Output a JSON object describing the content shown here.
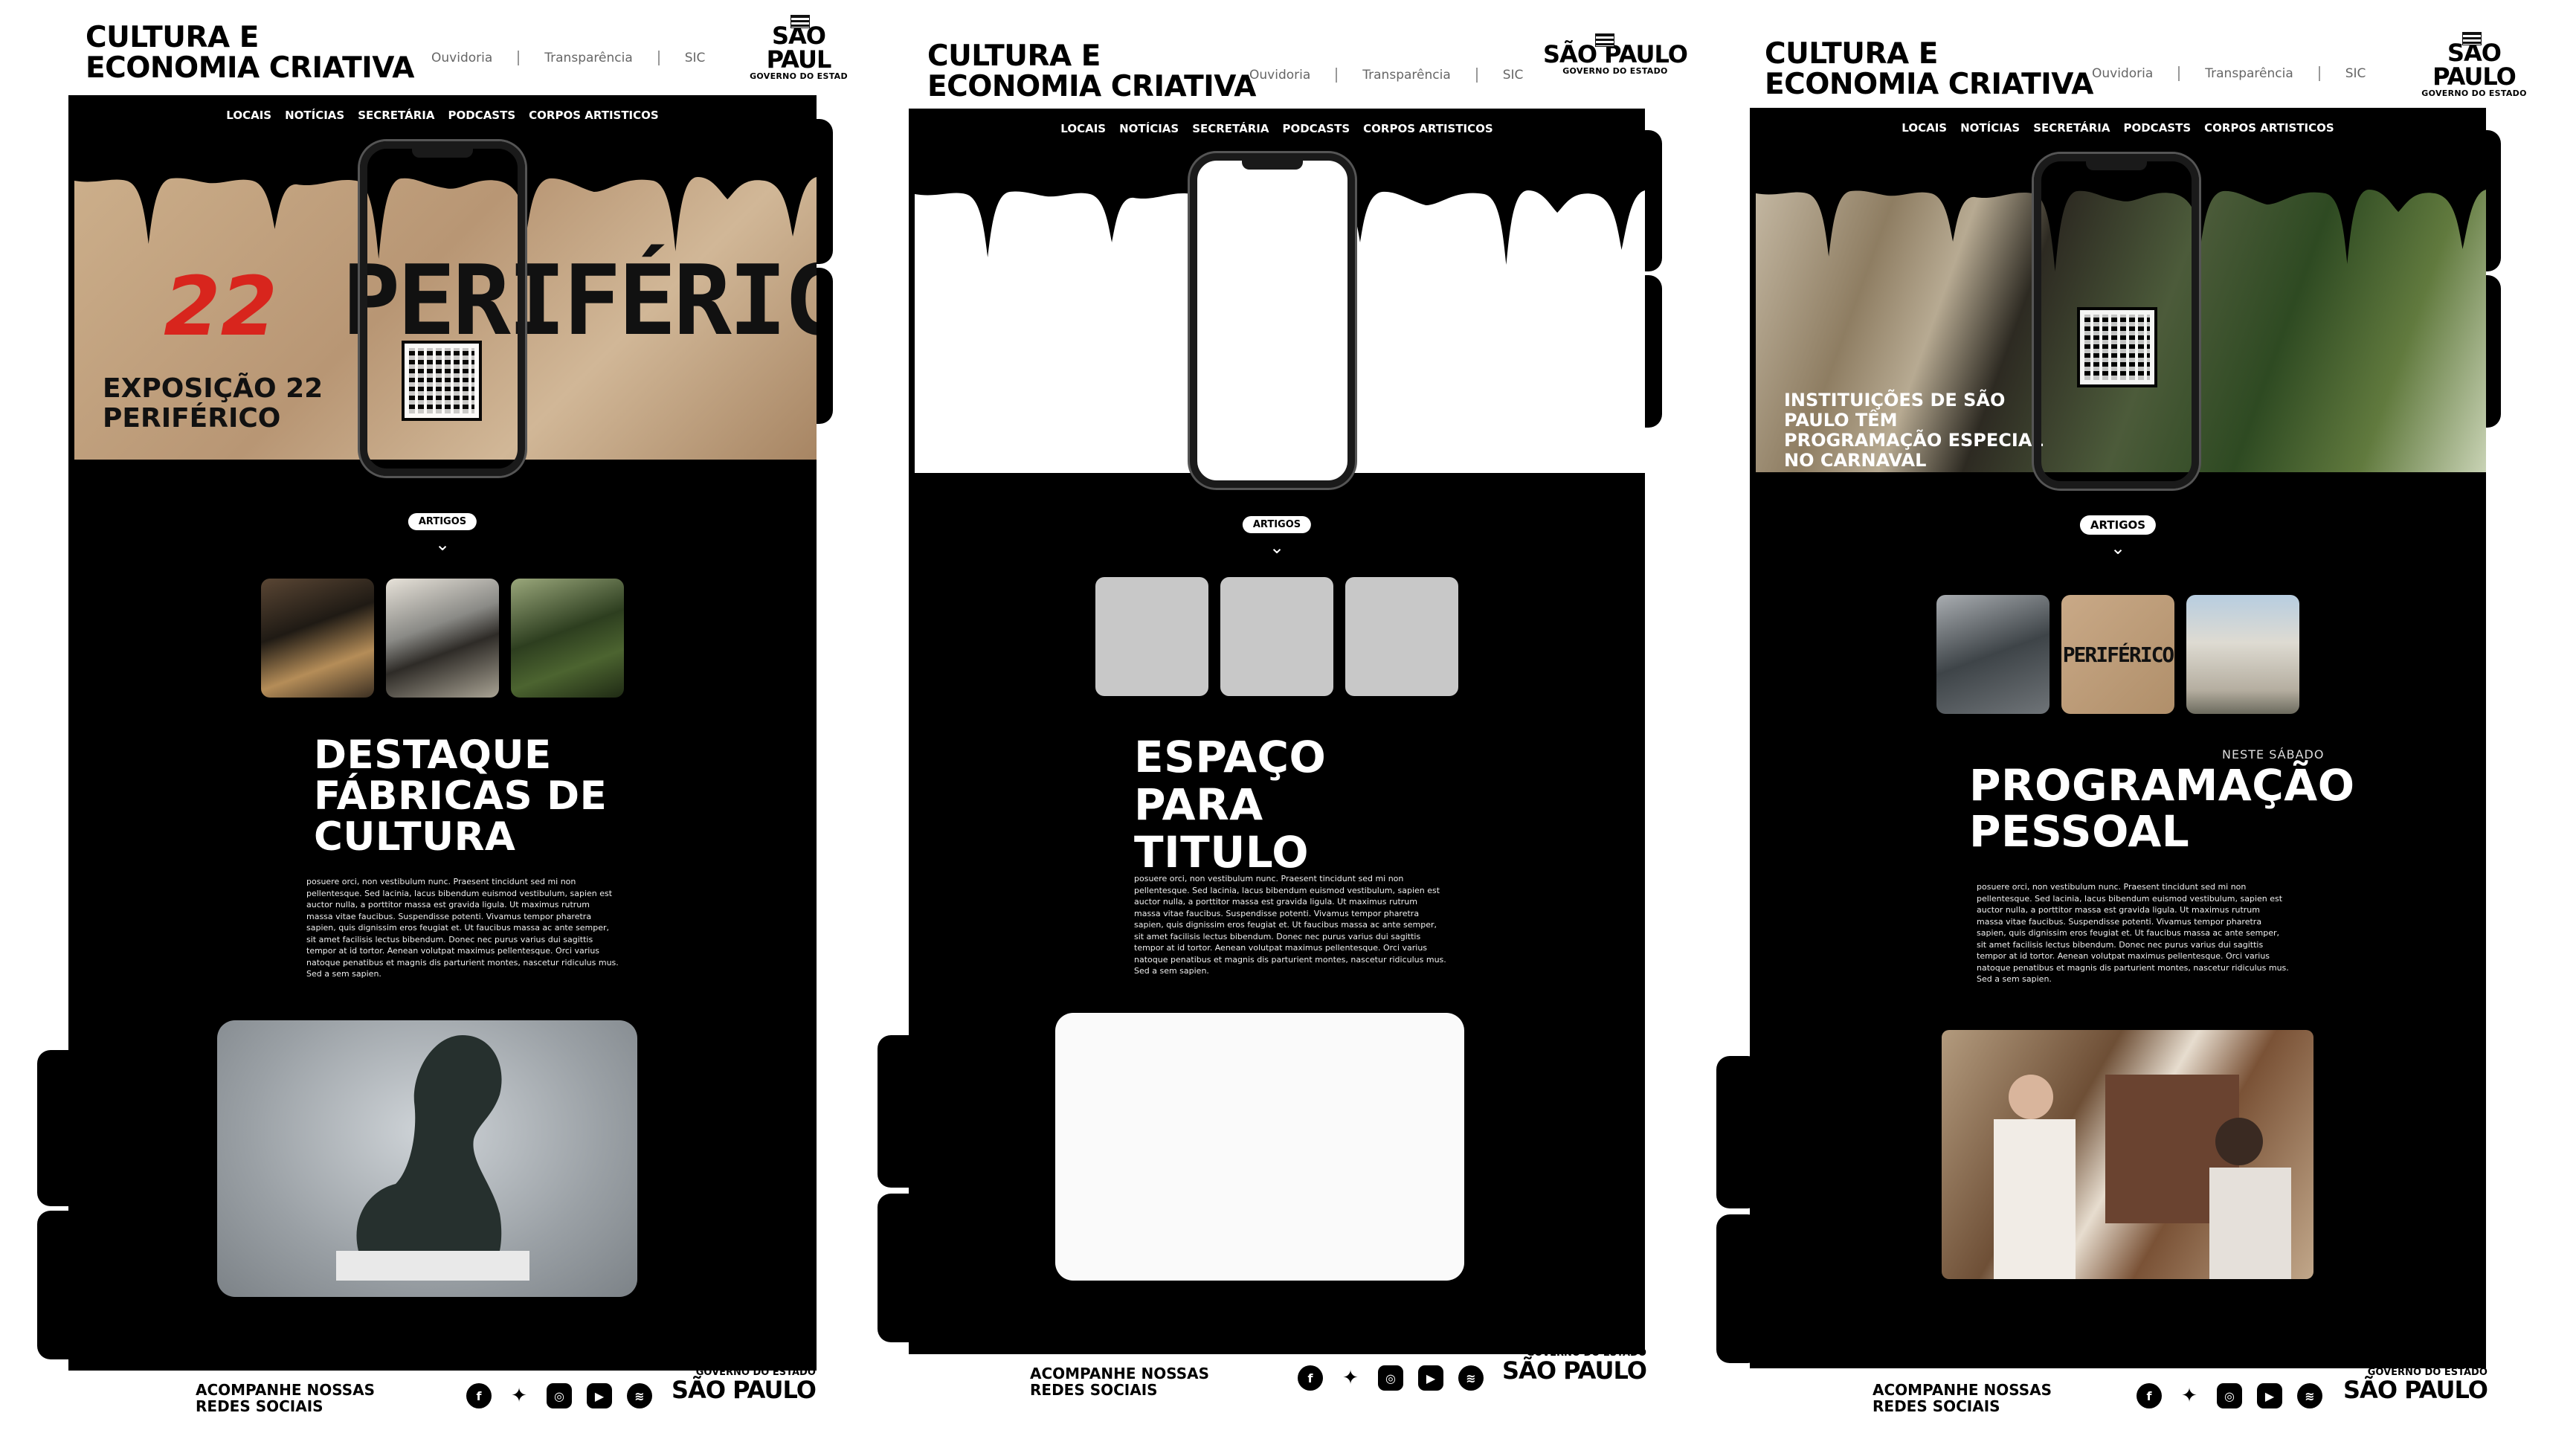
{
  "header": {
    "title_line1": "CULTURA E",
    "title_line2": "ECONOMIA CRIATIVA",
    "links": [
      "Ouvidoria",
      "Transparência",
      "SIC"
    ],
    "logo_main": "SÃO PAULO",
    "logo_sub": "GOVERNO DO ESTADO",
    "logo_main_clipped": "SÃO PAUL",
    "logo_sub_clipped": "GOVERNO DO ESTAD"
  },
  "nav": [
    "LOCAIS",
    "NOTÍCIAS",
    "SECRETÁRIA",
    "PODCASTS",
    "CORPOS ARTISTICOS"
  ],
  "panel1": {
    "hero_brand_num": "22",
    "hero_brand_word": "PERIFÉRICO",
    "hero_title": "EXPOSIÇÃO 22 PERIFÉRICO",
    "section_tag": "ARTIGOS",
    "section_title": "DESTAQUE FÁBRICAS DE CULTURA"
  },
  "panel2": {
    "section_tag": "ARTIGOS",
    "section_title": "ESPAÇO PARA TITULO"
  },
  "panel3": {
    "hero_title": "INSTITUIÇÕES DE SÃO PAULO TÊM PROGRAMAÇÃO ESPECIAL NO CARNAVAL",
    "section_tag": "ARTIGOS",
    "thumb_label": "PERIFÉRICO",
    "section_pre": "NESTE SÁBADO",
    "section_title": "PROGRAMAÇÃO PESSOAL"
  },
  "lorem": "posuere orci, non vestibulum nunc. Praesent tincidunt sed mi non pellentesque. Sed lacinia, lacus bibendum euismod vestibulum, sapien est auctor nulla, a porttitor massa est gravida ligula. Ut maximus rutrum massa vitae faucibus. Suspendisse potenti. Vivamus tempor pharetra sapien, quis dignissim eros feugiat et. Ut faucibus massa ac ante semper, sit amet facilisis lectus bibendum. Donec nec purus varius dui sagittis tempor at id tortor. Aenean volutpat maximus pellentesque. Orci varius natoque penatibus et magnis dis parturient montes, nascetur ridiculus mus. Sed a sem sapien.",
  "footer": {
    "follow_line1": "ACOMPANHE NOSSAS",
    "follow_line2": "REDES SOCIAIS",
    "logo_gov": "GOVERNO DO ESTADO",
    "logo_sp": "SÃO PAULO",
    "socials": [
      "facebook-icon",
      "twitter-icon",
      "instagram-icon",
      "youtube-icon",
      "spotify-icon"
    ]
  },
  "colors": {
    "accent_red": "#d8251d",
    "frame": "#000000",
    "paper": "#c2a27f"
  }
}
